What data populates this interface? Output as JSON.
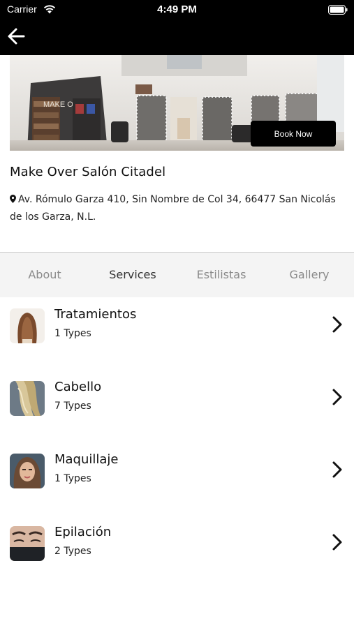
{
  "status_bar": {
    "carrier": "Carrier",
    "time": "4:49 PM"
  },
  "hero": {
    "book_label": "Book Now",
    "sign_text": "MAKE OV"
  },
  "salon": {
    "name": "Make Over Salón Citadel",
    "address": "Av. Rómulo Garza 410, Sin Nombre de Col 34, 66477 San Nicolás de los Garza, N.L."
  },
  "tabs": [
    {
      "label": "About",
      "active": false
    },
    {
      "label": "Services",
      "active": true
    },
    {
      "label": "Estilistas",
      "active": false
    },
    {
      "label": "Gallery",
      "active": false
    }
  ],
  "services": [
    {
      "name": "Tratamientos",
      "types": "1 Types"
    },
    {
      "name": "Cabello",
      "types": "7 Types"
    },
    {
      "name": "Maquillaje",
      "types": "1 Types"
    },
    {
      "name": "Epilación",
      "types": "2 Types"
    }
  ],
  "colors": {
    "topbar": "#000000",
    "tab_bg": "#f4f4f4",
    "tab_active": "#333333",
    "tab_inactive": "#8a8a8a"
  },
  "icons": [
    "wifi-icon",
    "battery-icon",
    "back-arrow-icon",
    "map-pin-icon",
    "chevron-right-icon"
  ]
}
